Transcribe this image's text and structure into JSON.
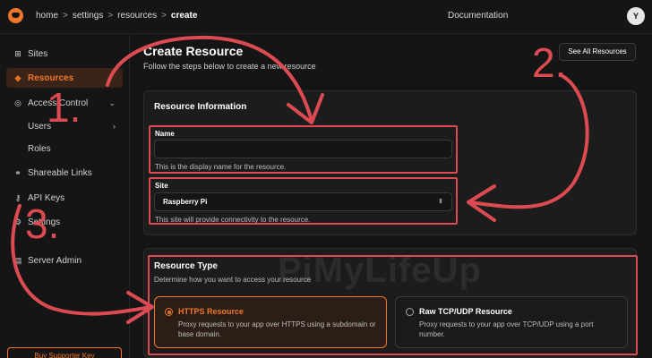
{
  "breadcrumbs": [
    "home",
    "settings",
    "resources",
    "create"
  ],
  "breadcrumb_sep": ">",
  "topbar": {
    "documentation": "Documentation",
    "avatar_initial": "Y"
  },
  "sidebar": {
    "items": [
      {
        "label": "Sites",
        "icon": "sites-icon"
      },
      {
        "label": "Resources",
        "icon": "resources-icon",
        "active": true
      },
      {
        "label": "Access Control",
        "icon": "access-control-icon"
      },
      {
        "label": "Users"
      },
      {
        "label": "Roles"
      },
      {
        "label": "Shareable Links",
        "icon": "link-icon"
      },
      {
        "label": "API Keys",
        "icon": "key-icon"
      },
      {
        "label": "Settings",
        "icon": "gear-icon"
      },
      {
        "label": "Server Admin",
        "icon": "server-icon"
      }
    ],
    "supporter_button": "Buy Supporter Key"
  },
  "page": {
    "title": "Create Resource",
    "subtitle": "Follow the steps below to create a new resource",
    "see_all_button": "See All Resources"
  },
  "resource_info": {
    "title": "Resource Information",
    "name_label": "Name",
    "name_value": "",
    "name_help": "This is the display name for the resource.",
    "site_label": "Site",
    "site_value": "Raspberry Pi",
    "site_help": "This site will provide connectivity to the resource."
  },
  "resource_type": {
    "title": "Resource Type",
    "subtitle": "Determine how you want to access your resource",
    "options": [
      {
        "title": "HTTPS Resource",
        "desc": "Proxy requests to your app over HTTPS using a subdomain or base domain.",
        "selected": true
      },
      {
        "title": "Raw TCP/UDP Resource",
        "desc": "Proxy requests to your app over TCP/UDP using a port number.",
        "selected": false
      }
    ]
  },
  "annotations": {
    "step1": "1.",
    "step2": "2.",
    "step3": "3."
  },
  "watermark": "PiMyLifeUp",
  "colors": {
    "accent": "#f0762b",
    "annotation": "#dd4b52",
    "background": "#151515"
  }
}
